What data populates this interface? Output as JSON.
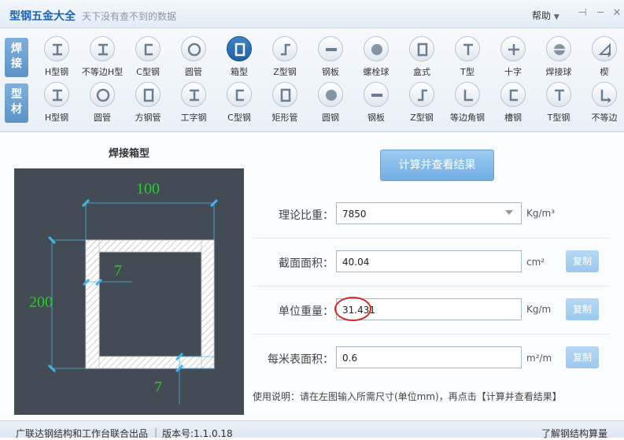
{
  "app": {
    "title": "型钢五金大全",
    "subtitle": "天下没有查不到的数据",
    "help_label": "帮助",
    "pin_glyph": "⊣",
    "minimize_glyph": "─",
    "close_glyph": "✕"
  },
  "toolbar": {
    "row1_tab": "焊\n接",
    "row2_tab": "型\n材",
    "row1_items": [
      {
        "label": "H型钢",
        "icon": "i-beam-icon"
      },
      {
        "label": "不等边H型",
        "icon": "unequal-h-beam-icon"
      },
      {
        "label": "C型钢",
        "icon": "c-channel-icon"
      },
      {
        "label": "圆管",
        "icon": "round-pipe-icon"
      },
      {
        "label": "箱型",
        "icon": "box-section-icon",
        "selected": true
      },
      {
        "label": "Z型钢",
        "icon": "z-section-icon"
      },
      {
        "label": "钢板",
        "icon": "steel-plate-icon"
      },
      {
        "label": "螺栓球",
        "icon": "bolt-ball-icon"
      },
      {
        "label": "盒式",
        "icon": "box-type-icon"
      },
      {
        "label": "T型",
        "icon": "t-section-icon"
      },
      {
        "label": "十字",
        "icon": "cross-section-icon"
      },
      {
        "label": "焊接球",
        "icon": "welded-ball-icon"
      },
      {
        "label": "楔",
        "icon": "wedge-icon"
      }
    ],
    "row2_items": [
      {
        "label": "H型钢",
        "icon": "i-beam-icon"
      },
      {
        "label": "圆管",
        "icon": "round-pipe-icon"
      },
      {
        "label": "方钢管",
        "icon": "square-pipe-icon"
      },
      {
        "label": "工字钢",
        "icon": "i-steel-icon"
      },
      {
        "label": "C型钢",
        "icon": "c-channel-icon"
      },
      {
        "label": "矩形管",
        "icon": "rect-pipe-icon"
      },
      {
        "label": "圆钢",
        "icon": "round-bar-icon"
      },
      {
        "label": "钢板",
        "icon": "steel-plate-icon"
      },
      {
        "label": "Z型钢",
        "icon": "z-section-icon"
      },
      {
        "label": "等边角钢",
        "icon": "angle-steel-icon"
      },
      {
        "label": "槽钢",
        "icon": "channel-steel-icon"
      },
      {
        "label": "T型钢",
        "icon": "t-steel-icon"
      },
      {
        "label": "不等边",
        "icon": "unequal-angle-icon"
      }
    ]
  },
  "panel": {
    "title": "焊接箱型",
    "dim_width": "100",
    "dim_height": "200",
    "dim_wall": "7",
    "dim_flange": "7"
  },
  "calc_button": "计算并查看结果",
  "fields": {
    "density": {
      "label": "理论比重：",
      "value": "7850",
      "unit": "Kg/m³"
    },
    "area": {
      "label": "截面面积：",
      "value": "40.04",
      "unit": "cm²",
      "copy": "复制"
    },
    "unit_weight": {
      "label": "单位重量：",
      "value": "31.431",
      "unit": "Kg/m",
      "copy": "复制"
    },
    "surface_area": {
      "label": "每米表面积：",
      "value": "0.6",
      "unit": "m²/m",
      "copy": "复制"
    }
  },
  "instructions": "使用说明：请在左图输入所需尺寸(单位mm)，再点击【计算并查看结果】",
  "status": {
    "publisher": "广联达钢结构和工作台联合出品",
    "version": "版本号:1.1.0.18",
    "link": "了解钢结构算量"
  },
  "colors": {
    "accent": "#1e64b4",
    "diagram_bg": "#434b55",
    "dimension_green": "#22d022",
    "highlight_red": "#d42b2b"
  }
}
